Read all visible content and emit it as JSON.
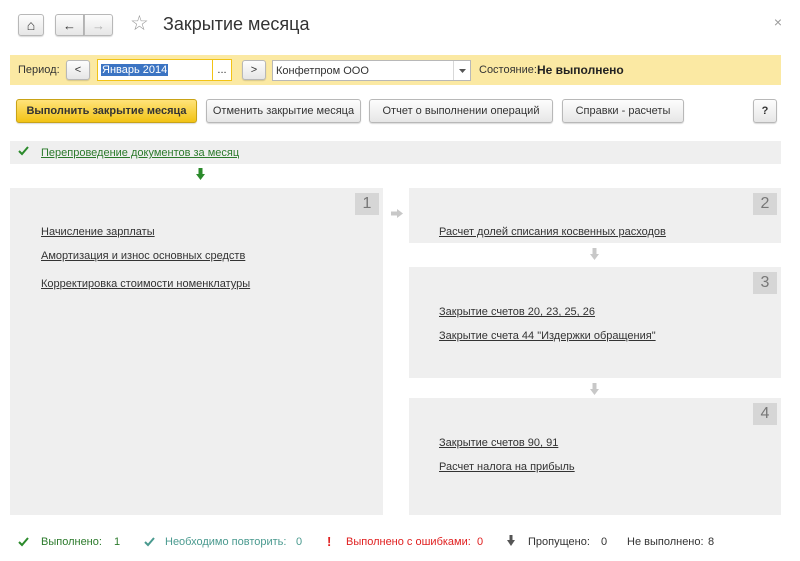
{
  "window": {
    "title": "Закрытие месяца",
    "close_glyph": "×"
  },
  "nav": {
    "home_glyph": "⌂",
    "back_glyph": "←",
    "forward_glyph": "→",
    "star_glyph": "☆"
  },
  "period_bar": {
    "period_label": "Период:",
    "prev_glyph": "<",
    "next_glyph": ">",
    "period_value": "Январь 2014",
    "pick_glyph": "...",
    "organization_value": "Конфетпром ООО",
    "status_label": "Состояние:",
    "status_value": "Не выполнено"
  },
  "toolbar": {
    "execute_label": "Выполнить закрытие месяца",
    "cancel_label": "Отменить закрытие месяца",
    "report_label": "Отчет о выполнении операций",
    "reference_label": "Справки - расчеты",
    "help_label": "?"
  },
  "repost": {
    "label": "Перепроведение документов за месяц"
  },
  "stages": [
    {
      "number": "1",
      "operations": [
        "Начисление зарплаты",
        "Амортизация и износ основных средств",
        "Корректировка стоимости номенклатуры"
      ]
    },
    {
      "number": "2",
      "operations": [
        "Расчет долей списания косвенных расходов"
      ]
    },
    {
      "number": "3",
      "operations": [
        "Закрытие счетов 20, 23, 25, 26",
        "Закрытие счета 44 \"Издержки обращения\""
      ]
    },
    {
      "number": "4",
      "operations": [
        "Закрытие счетов 90, 91",
        "Расчет налога на прибыль"
      ]
    }
  ],
  "footer": {
    "done_label": "Выполнено:",
    "done_count": "1",
    "repeat_label": "Необходимо повторить:",
    "repeat_count": "0",
    "errors_label": "Выполнено с ошибками:",
    "errors_count": "0",
    "skipped_label": "Пропущено:",
    "skipped_count": "0",
    "notdone_label": "Не выполнено:",
    "notdone_count": "8"
  },
  "colors": {
    "accent_yellow": "#f2c315",
    "period_bar_bg": "#fbe9a3",
    "success_green": "#2b8a2b",
    "repeat_teal": "#4a9a8f",
    "error_red": "#e02020",
    "panel_gray": "#efefef"
  }
}
